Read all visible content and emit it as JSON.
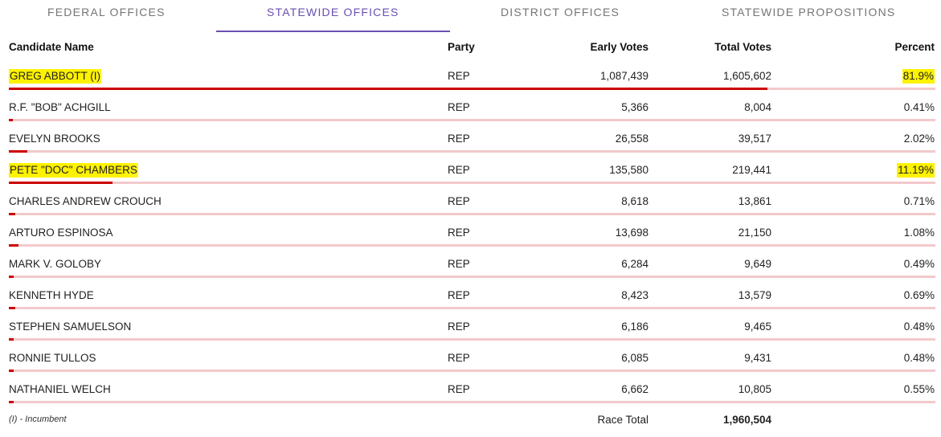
{
  "tabs": [
    {
      "label": "FEDERAL OFFICES",
      "active": false
    },
    {
      "label": "STATEWIDE OFFICES",
      "active": true
    },
    {
      "label": "DISTRICT OFFICES",
      "active": false
    },
    {
      "label": "STATEWIDE PROPOSITIONS",
      "active": false
    }
  ],
  "headers": {
    "name": "Candidate Name",
    "party": "Party",
    "early": "Early Votes",
    "total": "Total Votes",
    "percent": "Percent"
  },
  "colors": {
    "accent": "#6a4fb3",
    "bar": "#cc0000",
    "bar_track": "#f3c9cc",
    "highlight": "#fff200"
  },
  "rows": [
    {
      "name": "GREG ABBOTT (I)",
      "party": "REP",
      "early": "1,087,439",
      "total": "1,605,602",
      "percent": "81.9%",
      "pct_value": 81.9,
      "highlighted": true
    },
    {
      "name": "R.F. \"BOB\" ACHGILL",
      "party": "REP",
      "early": "5,366",
      "total": "8,004",
      "percent": "0.41%",
      "pct_value": 0.41,
      "highlighted": false
    },
    {
      "name": "EVELYN BROOKS",
      "party": "REP",
      "early": "26,558",
      "total": "39,517",
      "percent": "2.02%",
      "pct_value": 2.02,
      "highlighted": false
    },
    {
      "name": "PETE \"DOC\" CHAMBERS",
      "party": "REP",
      "early": "135,580",
      "total": "219,441",
      "percent": "11.19%",
      "pct_value": 11.19,
      "highlighted": true
    },
    {
      "name": "CHARLES ANDREW CROUCH",
      "party": "REP",
      "early": "8,618",
      "total": "13,861",
      "percent": "0.71%",
      "pct_value": 0.71,
      "highlighted": false
    },
    {
      "name": "ARTURO ESPINOSA",
      "party": "REP",
      "early": "13,698",
      "total": "21,150",
      "percent": "1.08%",
      "pct_value": 1.08,
      "highlighted": false
    },
    {
      "name": "MARK V. GOLOBY",
      "party": "REP",
      "early": "6,284",
      "total": "9,649",
      "percent": "0.49%",
      "pct_value": 0.49,
      "highlighted": false
    },
    {
      "name": "KENNETH HYDE",
      "party": "REP",
      "early": "8,423",
      "total": "13,579",
      "percent": "0.69%",
      "pct_value": 0.69,
      "highlighted": false
    },
    {
      "name": "STEPHEN SAMUELSON",
      "party": "REP",
      "early": "6,186",
      "total": "9,465",
      "percent": "0.48%",
      "pct_value": 0.48,
      "highlighted": false
    },
    {
      "name": "RONNIE TULLOS",
      "party": "REP",
      "early": "6,085",
      "total": "9,431",
      "percent": "0.48%",
      "pct_value": 0.48,
      "highlighted": false
    },
    {
      "name": "NATHANIEL WELCH",
      "party": "REP",
      "early": "6,662",
      "total": "10,805",
      "percent": "0.55%",
      "pct_value": 0.55,
      "highlighted": false
    }
  ],
  "footer": {
    "incumbent_note": "(I) - Incumbent",
    "race_total_label": "Race Total",
    "race_total_value": "1,960,504"
  }
}
